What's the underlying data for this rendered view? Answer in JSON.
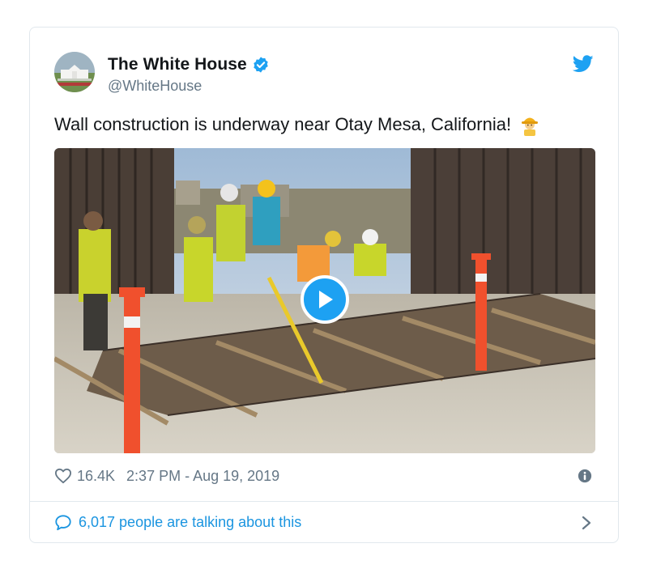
{
  "tweet": {
    "display_name": "The White House",
    "handle": "@WhiteHouse",
    "text": "Wall construction is underway near Otay Mesa, California!",
    "emoji": "construction-worker-emoji",
    "likes": "16.4K",
    "timestamp": "2:37 PM - Aug 19, 2019",
    "talking": "6,017 people are talking about this"
  },
  "icons": {
    "verified": "verified-badge-icon",
    "twitter": "twitter-bird-icon",
    "heart": "heart-icon",
    "info": "info-icon",
    "comment": "speech-bubble-icon",
    "chevron": "chevron-right-icon",
    "play": "play-icon"
  },
  "colors": {
    "twitter_blue": "#1da1f2",
    "link_blue": "#1b95e0",
    "secondary_text": "#657786",
    "border": "#e1e8ed"
  }
}
